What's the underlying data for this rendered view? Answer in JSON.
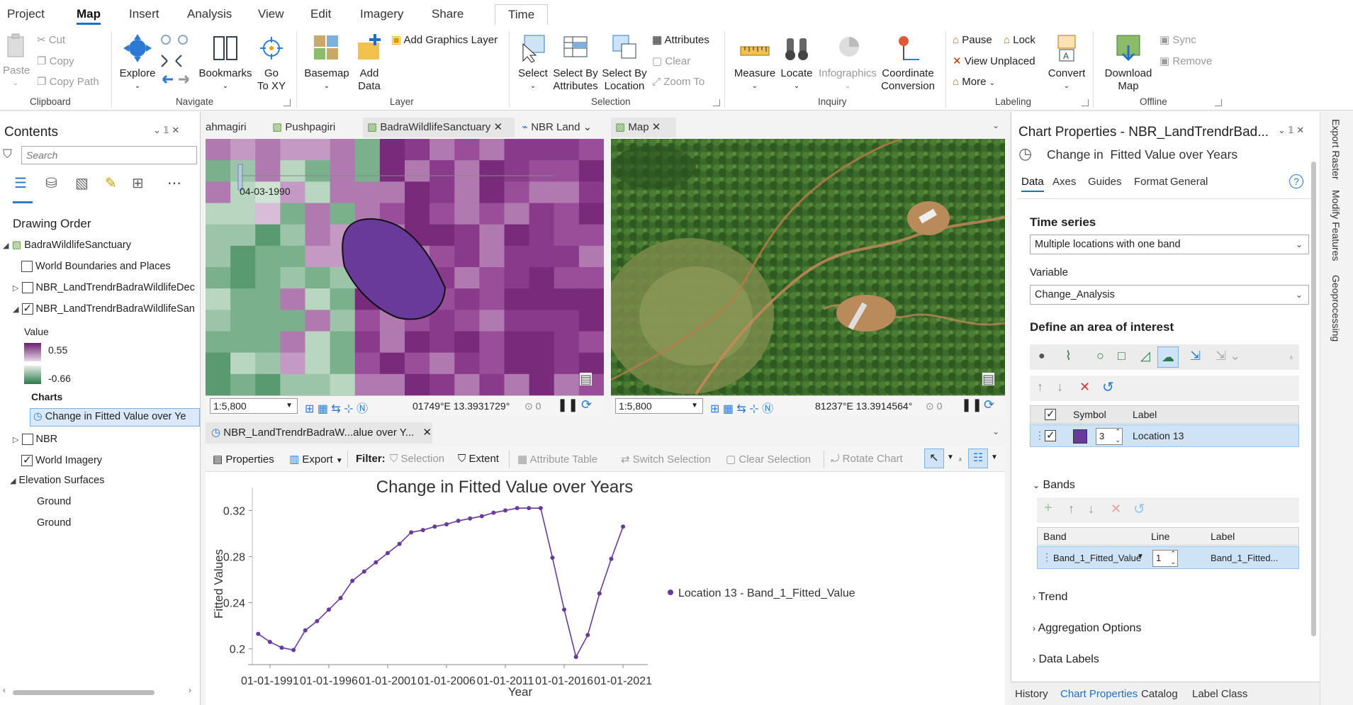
{
  "ribbon": {
    "tabs": [
      "Project",
      "Map",
      "Insert",
      "Analysis",
      "View",
      "Edit",
      "Imagery",
      "Share",
      "Time"
    ],
    "active_tab": "Map",
    "groups": {
      "clipboard": {
        "label": "Clipboard",
        "paste": "Paste",
        "cut": "Cut",
        "copy": "Copy",
        "copy_path": "Copy Path"
      },
      "navigate": {
        "label": "Navigate",
        "explore": "Explore",
        "bookmarks": "Bookmarks",
        "goto": "Go\nTo XY"
      },
      "layer": {
        "label": "Layer",
        "basemap": "Basemap",
        "add_data": "Add\nData",
        "add_graphics": "Add Graphics Layer"
      },
      "selection": {
        "label": "Selection",
        "select": "Select",
        "select_by_attr": "Select By\nAttributes",
        "select_by_loc": "Select By\nLocation",
        "attributes": "Attributes",
        "clear": "Clear",
        "zoom_to": "Zoom To"
      },
      "inquiry": {
        "label": "Inquiry",
        "measure": "Measure",
        "locate": "Locate",
        "infographics": "Infographics",
        "coord_conv": "Coordinate\nConversion"
      },
      "labeling": {
        "label": "Labeling",
        "pause": "Pause",
        "lock": "Lock",
        "view_unplaced": "View Unplaced",
        "more": "More",
        "convert": "Convert"
      },
      "offline": {
        "label": "Offline",
        "download_map": "Download\nMap",
        "sync": "Sync",
        "remove": "Remove"
      }
    }
  },
  "contents": {
    "title": "Contents",
    "search_placeholder": "Search",
    "drawing_order": "Drawing Order",
    "items": {
      "map": "BadraWildlifeSanctuary",
      "world_boundaries": "World Boundaries and Places",
      "nbr_dec": "NBR_LandTrendrBadraWildlifeDec",
      "nbr_san": "NBR_LandTrendrBadraWildlifeSan",
      "value_label": "Value",
      "value_max": "0.55",
      "value_min": "-0.66",
      "charts_label": "Charts",
      "chart_item": "Change in  Fitted Value over Ye",
      "nbr": "NBR",
      "world_imagery": "World Imagery",
      "elevation": "Elevation Surfaces",
      "ground1": "Ground",
      "ground2": "Ground"
    }
  },
  "views": {
    "tabs": [
      "ahmagiri",
      "Pushpagiri",
      "BadraWildlifeSanctuary",
      "NBR Land",
      "Map"
    ],
    "left_date": "04-03-1990",
    "left_scale": "1:5,800",
    "left_coord": "01749°E 13.3931729°",
    "left_count": "0",
    "right_scale": "1:5,800",
    "right_coord": "81237°E 13.3914564°",
    "right_count": "0",
    "chart_tab": "NBR_LandTrendrBadraW...alue over Y..."
  },
  "chart_toolbar": {
    "properties": "Properties",
    "export": "Export",
    "filter": "Filter:",
    "selection": "Selection",
    "extent": "Extent",
    "attribute_table": "Attribute Table",
    "switch_selection": "Switch Selection",
    "clear_selection": "Clear Selection",
    "rotate_chart": "Rotate Chart"
  },
  "chart_data": {
    "type": "line",
    "title": "Change in Fitted Value over Years",
    "xlabel": "Year",
    "ylabel": "Fitted Values",
    "x_tick_labels": [
      "01-01-1991",
      "01-01-1996",
      "01-01-2001",
      "01-01-2006",
      "01-01-2011",
      "01-01-2016",
      "01-01-2021"
    ],
    "y_ticks": [
      0.2,
      0.24,
      0.28,
      0.32
    ],
    "ylim": [
      0.19,
      0.335
    ],
    "xlim": [
      1989.5,
      2022.5
    ],
    "legend_position": "right",
    "series": [
      {
        "name": "Location 13 - Band_1_Fitted_Value",
        "color": "#6a3a9a",
        "x": [
          1990,
          1991,
          1992,
          1993,
          1994,
          1995,
          1996,
          1997,
          1998,
          1999,
          2000,
          2001,
          2002,
          2003,
          2004,
          2005,
          2006,
          2007,
          2008,
          2009,
          2010,
          2011,
          2012,
          2013,
          2014,
          2015,
          2016,
          2017,
          2018,
          2019,
          2020,
          2021
        ],
        "y": [
          0.213,
          0.206,
          0.201,
          0.199,
          0.216,
          0.224,
          0.234,
          0.244,
          0.259,
          0.267,
          0.275,
          0.283,
          0.291,
          0.301,
          0.303,
          0.306,
          0.308,
          0.311,
          0.313,
          0.315,
          0.318,
          0.32,
          0.322,
          0.322,
          0.322,
          0.279,
          0.234,
          0.193,
          0.212,
          0.248,
          0.278,
          0.306
        ]
      }
    ]
  },
  "props": {
    "title": "Chart Properties - NBR_LandTrendrBad...",
    "chart_name": "Change in  Fitted Value over Years",
    "tabs": [
      "Data",
      "Axes",
      "Guides",
      "Format",
      "General"
    ],
    "active_tab": "Data",
    "time_series_label": "Time series",
    "time_series_value": "Multiple locations with one band",
    "variable_label": "Variable",
    "variable_value": "Change_Analysis",
    "aoi_label": "Define an area of interest",
    "grid_symbol": "Symbol",
    "grid_label": "Label",
    "row_num": "3",
    "row_label": "Location 13",
    "bands_label": "Bands",
    "bands_band": "Band",
    "bands_line": "Line",
    "bands_lbl": "Label",
    "band_value": "Band_1_Fitted_Value",
    "band_line": "1",
    "band_label_value": "Band_1_Fitted...",
    "trend": "Trend",
    "aggregation": "Aggregation Options",
    "data_labels": "Data Labels",
    "swatch_color": "#6a3a9a"
  },
  "bottom_tabs": [
    "History",
    "Chart Properties",
    "Catalog",
    "Label Class"
  ],
  "side_strip": [
    "Export Raster",
    "Modify Features",
    "Geoprocessing"
  ]
}
